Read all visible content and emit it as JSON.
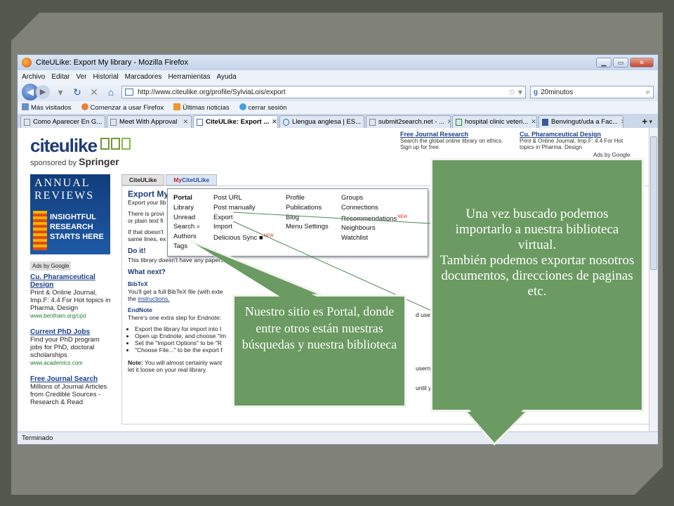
{
  "browser": {
    "title": "CiteULike: Export My library - Mozilla Firefox",
    "menu": [
      "Archivo",
      "Editar",
      "Ver",
      "Historial",
      "Marcadores",
      "Herramientas",
      "Ayuda"
    ],
    "url": "http://www.citeulike.org/profile/SylviaLois/export",
    "search_value": "20minutos",
    "bookmarks": [
      "Más visitados",
      "Comenzar a usar Firefox",
      "Últimas noticias",
      "cerrar sesión"
    ],
    "tabs": [
      {
        "label": "Como Aparecer En G...",
        "active": false
      },
      {
        "label": "Meet With Approval",
        "active": false
      },
      {
        "label": "CiteULike: Export ...",
        "active": true
      },
      {
        "label": "Llengua anglesa | ES...",
        "active": false
      },
      {
        "label": "submit2search.net - ...",
        "active": false
      },
      {
        "label": "hospital clinic veteri...",
        "active": false
      },
      {
        "label": "Benvingut/uda a Fac...",
        "active": false
      }
    ],
    "status": "Terminado"
  },
  "site": {
    "logo": "citeulike",
    "sponsored_by": "sponsored by",
    "sponsor_name": "Springer",
    "ads_by_google": "Ads by Google",
    "top_ads": [
      {
        "title": "Free Journal Research",
        "text": "Search the global online library on ethics. Sign up for free."
      },
      {
        "title": "Cu. Pharamceutical Design",
        "text": "Print & Online Journal, Imp.F: 4.4 For Hot topics in Pharma. Design"
      }
    ],
    "banner": {
      "line1": "ANNUAL",
      "line2": "REVIEWS",
      "line3": "INSIGHTFUL",
      "line4": "RESEARCH",
      "line5": "STARTS HERE"
    },
    "left_ads": [
      {
        "title": "Cu. Pharamceutical Design",
        "text": "Print & Online Journal, Imp.F: 4.4 For Hot topics in Pharma. Design",
        "url": "www.bentham.org/cpd"
      },
      {
        "title": "Current PhD Jobs",
        "text": "Find your PhD program jobs for PhD, doctoral scholarships",
        "url": "www.academics.com"
      },
      {
        "title": "Free Journal Search",
        "text": "Millions of Journal Articles from Credible Sources - Research & Read",
        "url": ""
      }
    ],
    "page_tabs": {
      "citeulike": "CiteULike",
      "my_prefix": "My",
      "my_suffix": "CiteULike"
    },
    "main": {
      "title": "Export My",
      "subtitle": "Export your lib",
      "p1": "There is provi",
      "p1b": "or plain text fi",
      "p2": "If that doesn't",
      "p2b": "same lines, ex",
      "do_it": "Do it!",
      "do_it_text": "This library doesn't have any papers",
      "what_next": "What next?",
      "bibtex": "BibTeX",
      "bibtex_text": "You'll get a full BibTeX file (with exte",
      "bibtex_text_b": "the",
      "bibtex_link": "instructions.",
      "bibtex_right": "d use an",
      "endnote": "EndNote",
      "endnote_text": "There's one extra step for Endnote:",
      "endnote_steps": [
        "Export the library for import into I",
        "Open up Endnote, and choose \"Im",
        "Set the \"Import Options\" to be \"R",
        "\"Choose File...\" to be the export f"
      ],
      "endnote_right": "usernam",
      "note_label": "Note:",
      "note_text": "You will almost certainly want",
      "note_text_b": "let it loose on your real library.",
      "note_right": "until yo"
    },
    "dropdown": {
      "col1": [
        "Portal",
        "Library",
        "Unread",
        "Search",
        "Authors",
        "Tags"
      ],
      "col2": [
        "Post URL",
        "Post manually",
        "Export",
        "Import",
        "Delicious Sync"
      ],
      "col3": [
        "Profile",
        "Publications",
        "Blog",
        "Menu Settings"
      ],
      "col4": [
        "Groups",
        "Connections",
        "Recommendations",
        "Neighbours",
        "Watchlist"
      ],
      "new_badge": "NEW"
    }
  },
  "callouts": {
    "right": "Una vez buscado podemos importarlo a nuestra biblioteca virtual.\nTambién podemos exportar nosotros documentos, direcciones de paginas etc.",
    "left": "Nuestro sitio es Portal, donde entre otros están nuestras búsquedas y nuestra biblioteca"
  }
}
